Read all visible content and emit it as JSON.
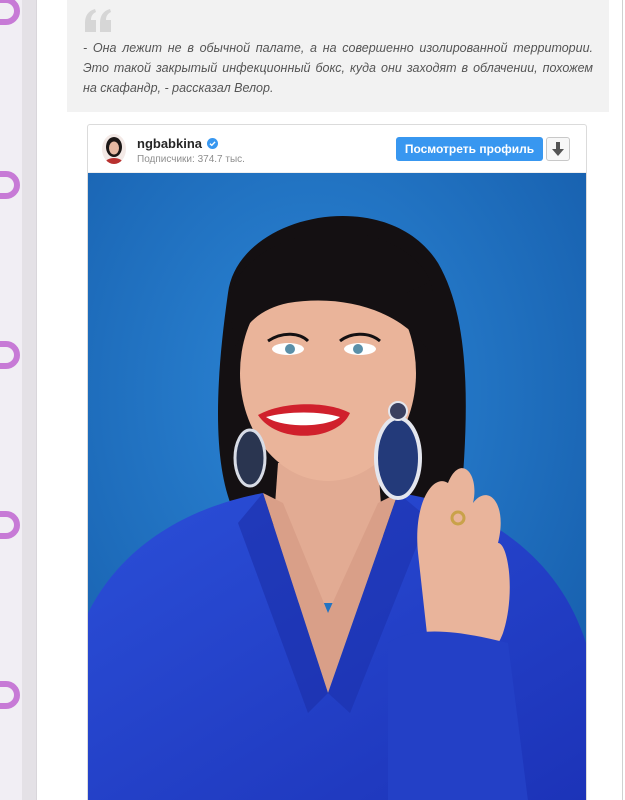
{
  "quote": {
    "text": "- Она лежит не в обычной палате, а на совершенно изолированной территории. Это такой закрытый инфекционный бокс, куда они заходят в облачении, похожем на скафандр, - рассказал Велор."
  },
  "instagram_embed": {
    "username": "ngbabkina",
    "followers": "Подписчики: 374.7 тыс.",
    "view_profile_label": "Посмотреть профиль",
    "verified_icon": "verified-badge-icon",
    "download_icon": "download-arrow-icon"
  },
  "theme": {
    "accent": "#3897f0",
    "quote_bg": "#f2f2f2",
    "photo_bg": "#1f6fc0",
    "strip_icon": "#c77ad6"
  }
}
